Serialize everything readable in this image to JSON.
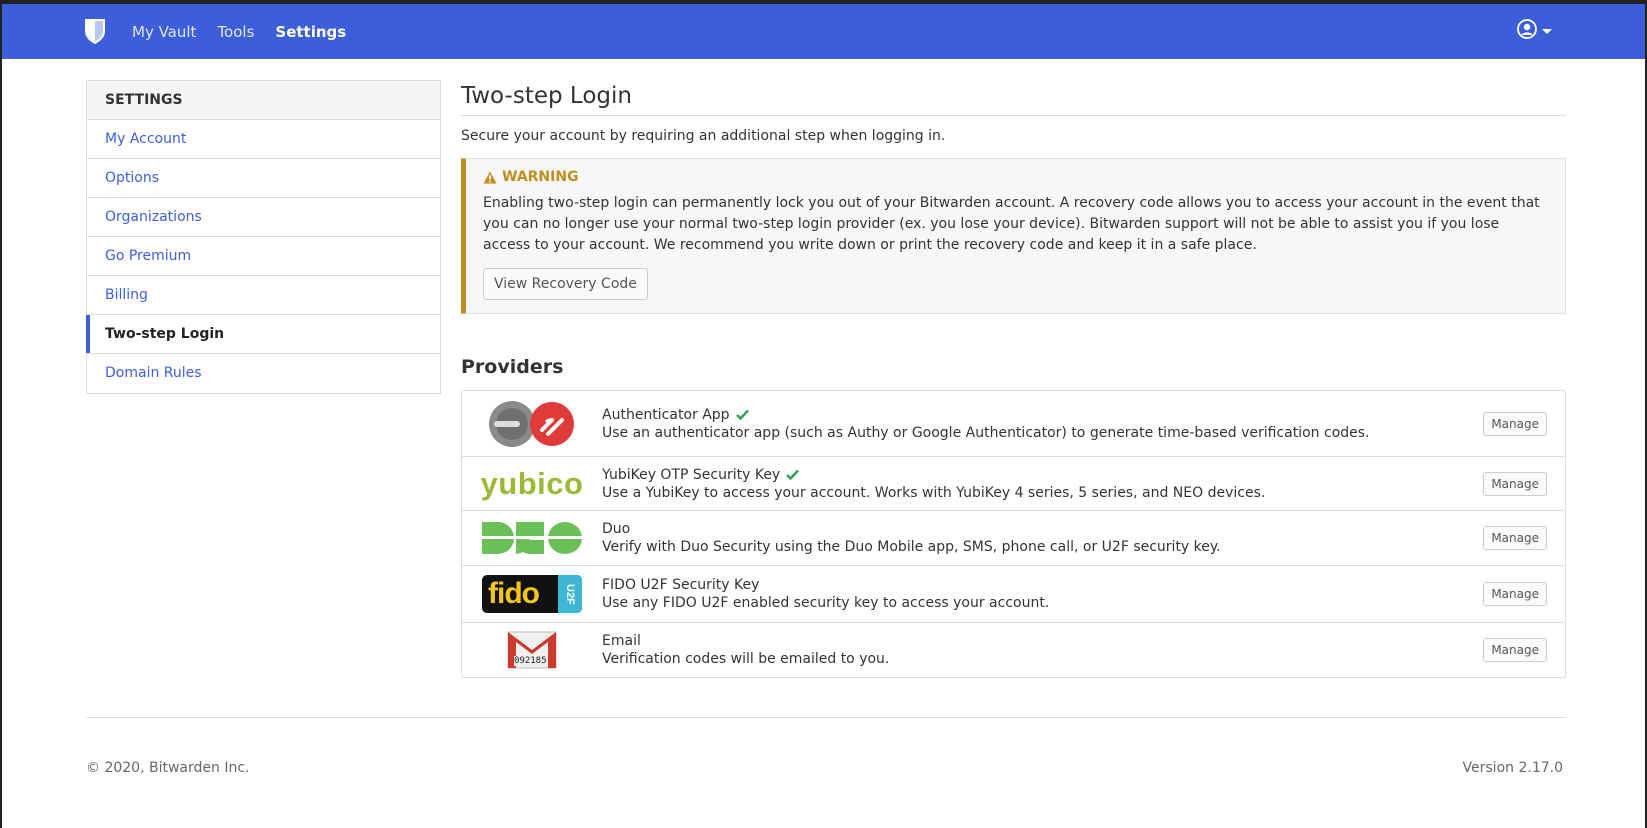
{
  "nav": {
    "links": [
      "My Vault",
      "Tools",
      "Settings"
    ],
    "active": "Settings"
  },
  "sidebar": {
    "header": "SETTINGS",
    "items": [
      {
        "label": "My Account"
      },
      {
        "label": "Options"
      },
      {
        "label": "Organizations"
      },
      {
        "label": "Go Premium"
      },
      {
        "label": "Billing"
      },
      {
        "label": "Two-step Login"
      },
      {
        "label": "Domain Rules"
      }
    ],
    "active": "Two-step Login"
  },
  "main": {
    "title": "Two-step Login",
    "subtitle": "Secure your account by requiring an additional step when logging in.",
    "warning": {
      "title": "WARNING",
      "text": "Enabling two-step login can permanently lock you out of your Bitwarden account. A recovery code allows you to access your account in the event that you can no longer use your normal two-step login provider (ex. you lose your device). Bitwarden support will not be able to assist you if you lose access to your account. We recommend you write down or print the recovery code and keep it in a safe place.",
      "button": "View Recovery Code"
    },
    "providers_title": "Providers",
    "providers": [
      {
        "name": "Authenticator App",
        "desc": "Use an authenticator app (such as Authy or Google Authenticator) to generate time-based verification codes.",
        "enabled": true,
        "button": "Manage"
      },
      {
        "name": "YubiKey OTP Security Key",
        "desc": "Use a YubiKey to access your account. Works with YubiKey 4 series, 5 series, and NEO devices.",
        "enabled": true,
        "button": "Manage"
      },
      {
        "name": "Duo",
        "desc": "Verify with Duo Security using the Duo Mobile app, SMS, phone call, or U2F security key.",
        "enabled": false,
        "button": "Manage"
      },
      {
        "name": "FIDO U2F Security Key",
        "desc": "Use any FIDO U2F enabled security key to access your account.",
        "enabled": false,
        "button": "Manage"
      },
      {
        "name": "Email",
        "desc": "Verification codes will be emailed to you.",
        "enabled": false,
        "button": "Manage"
      }
    ],
    "logos": {
      "yubico": "yubico",
      "fido": "fido",
      "u2f": "U2F",
      "email_code": "092185"
    }
  },
  "footer": {
    "copyright": "© 2020, Bitwarden Inc.",
    "version": "Version 2.17.0"
  },
  "colors": {
    "brand": "#3c5fd9",
    "warning": "#bf8e1f",
    "success": "#2e9e4f"
  }
}
